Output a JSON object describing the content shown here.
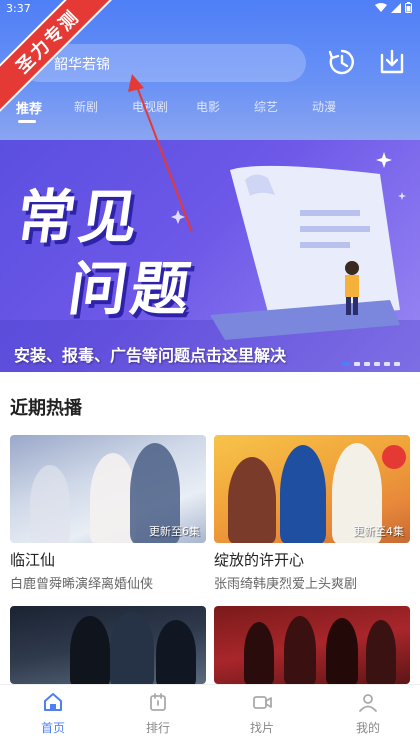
{
  "status_bar": {
    "time": "3:37"
  },
  "watermark": {
    "text": "圣力专测"
  },
  "search": {
    "value": "韶华若锦"
  },
  "tabs": [
    {
      "label": "推荐",
      "active": true
    },
    {
      "label": "新剧"
    },
    {
      "label": "电视剧"
    },
    {
      "label": "电影"
    },
    {
      "label": "综艺"
    },
    {
      "label": "动漫"
    }
  ],
  "banner": {
    "title_line1": "常见",
    "title_line2": "问题",
    "caption": "安装、报毒、广告等问题点击这里解决",
    "dots": 6,
    "active_dot": 0
  },
  "section": {
    "title": "近期热播"
  },
  "cards": [
    {
      "title": "临江仙",
      "subtitle": "白鹿曾舜晞演绎离婚仙侠",
      "badge": "更新至6集"
    },
    {
      "title": "绽放的许开心",
      "subtitle": "张雨绮韩庚烈爱上头爽剧",
      "badge": "更新至4集"
    },
    {
      "title": "",
      "subtitle": "",
      "badge": ""
    },
    {
      "title": "",
      "subtitle": "",
      "badge": ""
    }
  ],
  "bottom_nav": [
    {
      "label": "首页",
      "icon": "home-icon",
      "active": true
    },
    {
      "label": "排行",
      "icon": "ranking-icon"
    },
    {
      "label": "找片",
      "icon": "video-icon"
    },
    {
      "label": "我的",
      "icon": "user-icon"
    }
  ],
  "colors": {
    "accent": "#4f7ff7",
    "watermark": "#e53935"
  }
}
